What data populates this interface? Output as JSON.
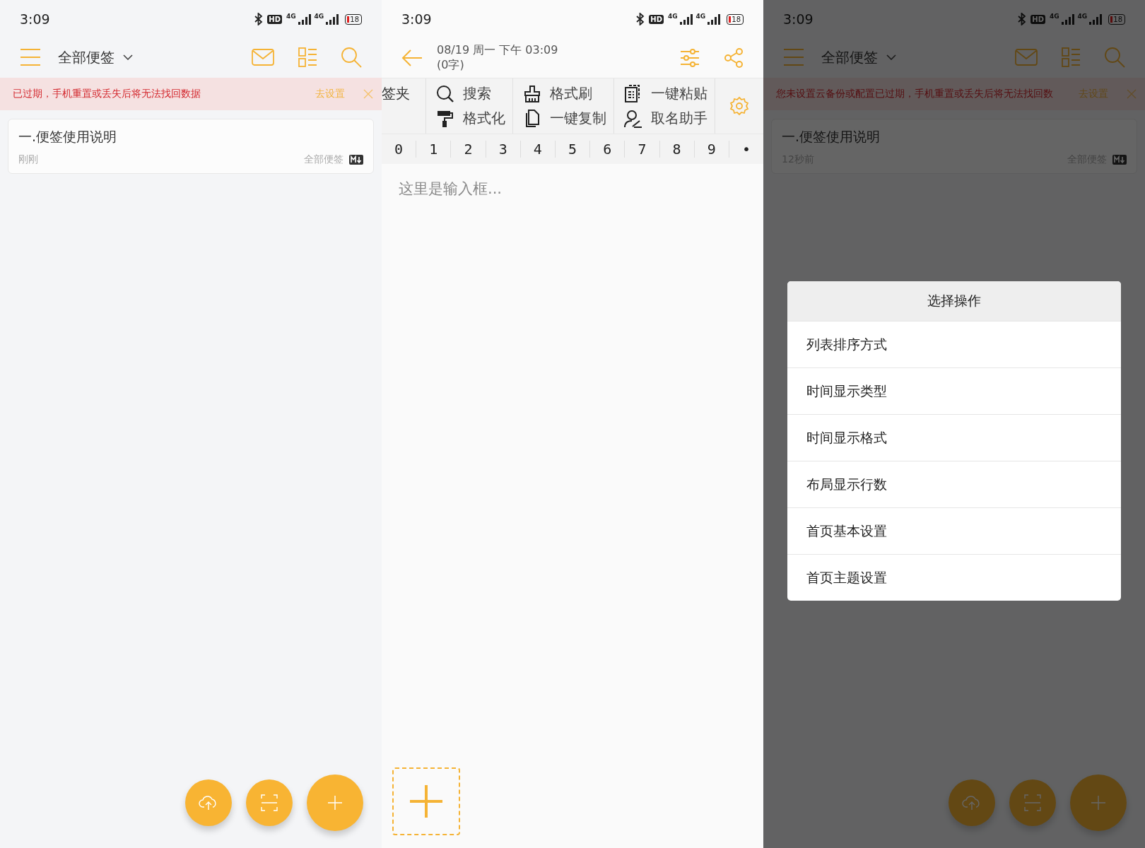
{
  "screens": [
    {
      "kind": "list",
      "status_bar": {
        "time": "3:09",
        "hd": "HD",
        "networks": [
          "4G",
          "4G"
        ],
        "battery": "18"
      },
      "header": {
        "title": "全部便签"
      },
      "banner": {
        "text": "已过期，手机重置或丢失后将无法找回数据",
        "action": "去设置"
      },
      "notes": [
        {
          "title": "一.便签使用说明",
          "time": "刚刚",
          "folder": "全部便签"
        }
      ]
    },
    {
      "kind": "editor",
      "status_bar": {
        "time": "3:09",
        "hd": "HD",
        "networks": [
          "4G",
          "4G"
        ],
        "battery": "18"
      },
      "header": {
        "date": "08/19 周一 下午 03:09",
        "count": "(0字)"
      },
      "toolbar": {
        "cut_label": "签夹",
        "tools": [
          {
            "label": "搜索",
            "kind": "search"
          },
          {
            "label": "格式化",
            "kind": "roller"
          },
          {
            "label": "格式刷",
            "kind": "brush"
          },
          {
            "label": "一键复制",
            "kind": "copy"
          },
          {
            "label": "一键粘贴",
            "kind": "paste"
          },
          {
            "label": "取名助手",
            "kind": "person"
          }
        ]
      },
      "keys": [
        "0",
        "1",
        "2",
        "3",
        "4",
        "5",
        "6",
        "7",
        "8",
        "9",
        "•"
      ],
      "placeholder": "这里是输入框..."
    },
    {
      "kind": "list",
      "dimmed": true,
      "status_bar": {
        "time": "3:09",
        "hd": "HD",
        "networks": [
          "4G",
          "4G"
        ],
        "battery": "18"
      },
      "header": {
        "title": "全部便签"
      },
      "banner": {
        "text": "您未设置云备份或配置已过期，手机重置或丢失后将无法找回数",
        "action": "去设置"
      },
      "notes": [
        {
          "title": "一.便签使用说明",
          "time": "12秒前",
          "folder": "全部便签"
        }
      ],
      "dialog": {
        "title": "选择操作",
        "options": [
          "列表排序方式",
          "时间显示类型",
          "时间显示格式",
          "布局显示行数",
          "首页基本设置",
          "首页主题设置"
        ]
      }
    }
  ]
}
